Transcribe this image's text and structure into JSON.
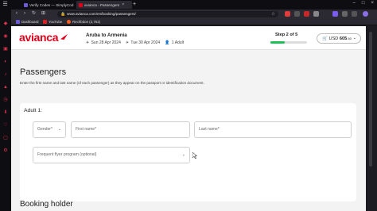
{
  "browser": {
    "tabs": [
      {
        "label": "Verify Codes — SimplyCod",
        "favicon_color": "#6b5bd6"
      },
      {
        "label": "avianca - Passengers",
        "favicon_color": "#e0001b"
      }
    ],
    "new_tab": "+",
    "url": "www.avianca.com/en/booking/passengers/",
    "bookmarks": [
      {
        "label": "Dashboard",
        "color": "#6b5bd6"
      },
      {
        "label": "YouTube",
        "color": "#e02020"
      },
      {
        "label": "Rechbdoe (2,752)",
        "color": "#ff5c1f"
      }
    ]
  },
  "header": {
    "logo": "avianca",
    "route": "Aruba to Armenia",
    "date_out": "Sun 28 Apr 2024",
    "date_back": "Tue 30 Apr 2024",
    "passengers": "1 Adult",
    "step": "Step 2 of 5",
    "step_progress": 0.4,
    "currency": "USD",
    "price": "605",
    "price_cents": ".50"
  },
  "main": {
    "title": "Passengers",
    "intro": "Enter the first name and last name (of each passenger) as they appear on the passport or identification document.",
    "adult": {
      "title": "Adult 1:",
      "gender_placeholder": "Gender*",
      "first_name_placeholder": "First name*",
      "last_name_placeholder": "Last name*",
      "ffp_placeholder": "Frequent flyer program (optional)"
    },
    "booking_holder_title": "Booking holder"
  },
  "colors": {
    "brand": "#e0001b",
    "progress": "#1fbf57",
    "sidebar_accent": "#e0334e"
  }
}
